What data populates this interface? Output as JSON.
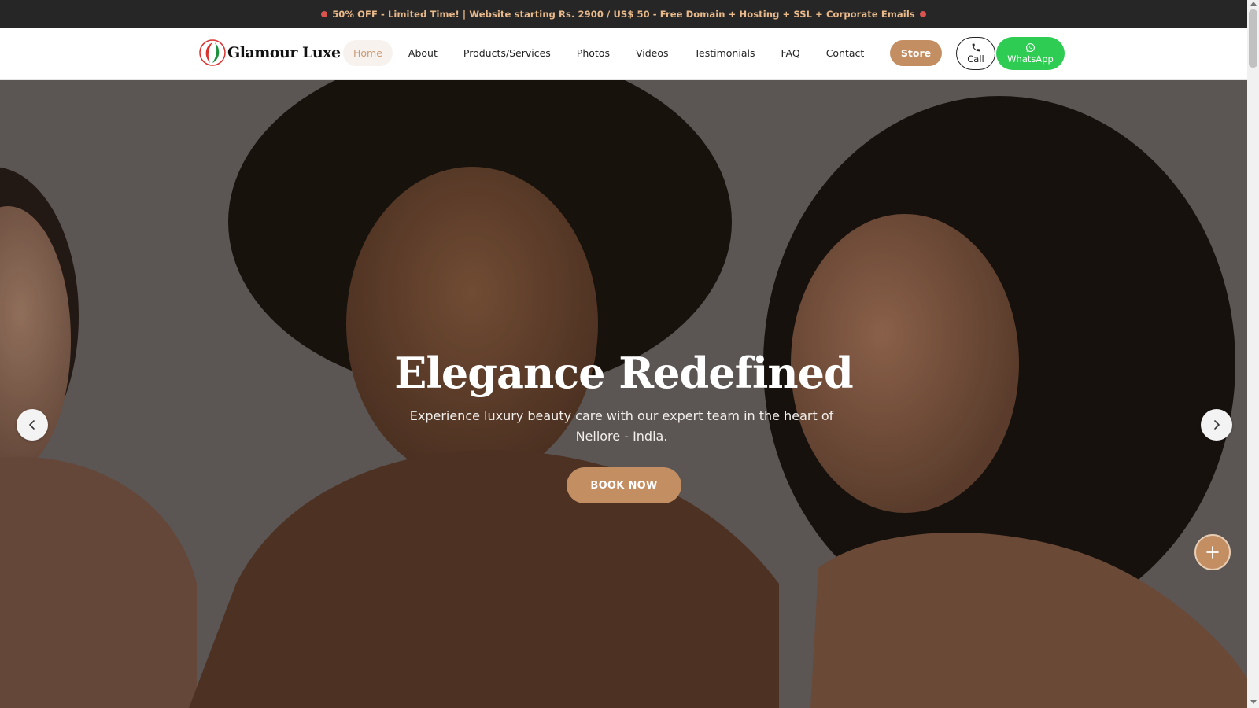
{
  "promo": {
    "text": "50% OFF - Limited Time! | Website starting Rs. 2900 / US$ 50 - Free Domain + Hosting + SSL + Corporate Emails",
    "dot_color": "#d9534f",
    "text_color": "#e9b98a"
  },
  "brand": {
    "name": "Glamour Luxe",
    "logo_icon": "leaf-logo-icon"
  },
  "nav": {
    "items": [
      {
        "label": "Home",
        "active": true
      },
      {
        "label": "About"
      },
      {
        "label": "Products/Services"
      },
      {
        "label": "Photos"
      },
      {
        "label": "Videos"
      },
      {
        "label": "Testimonials"
      },
      {
        "label": "FAQ"
      },
      {
        "label": "Contact"
      }
    ],
    "store_label": "Store",
    "call_label": "Call",
    "whatsapp_label": "WhatsApp"
  },
  "hero": {
    "title": "Elegance Redefined",
    "subtitle": "Experience luxury beauty care with our expert team in the heart of Nellore - India.",
    "cta_label": "BOOK NOW",
    "prev_icon": "chevron-left-icon",
    "next_icon": "chevron-right-icon"
  },
  "fab": {
    "icon": "plus-icon"
  },
  "colors": {
    "accent": "#c48e63",
    "whatsapp": "#2ecc52",
    "dark_bar": "#262626"
  }
}
